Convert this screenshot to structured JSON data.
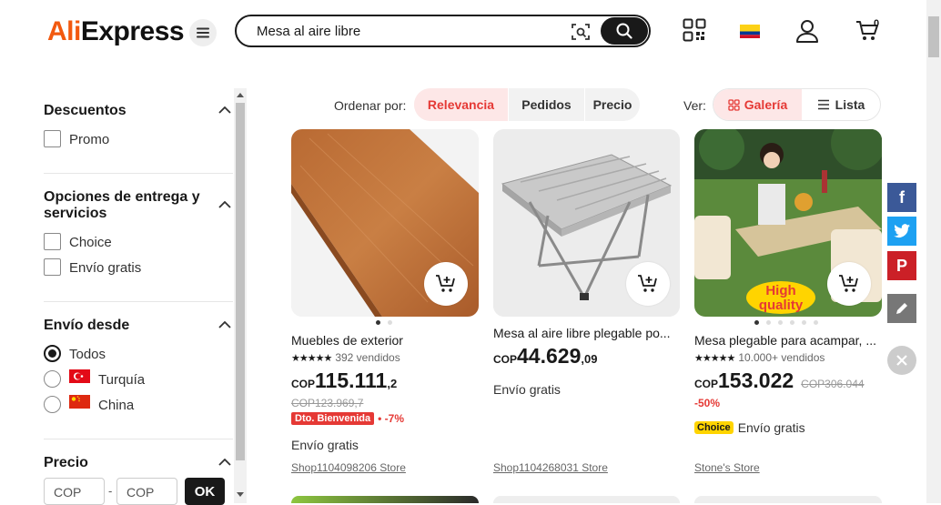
{
  "header": {
    "logo_prefix": "Ali",
    "logo_suffix": "Express",
    "search_value": "Mesa al aire libre",
    "cart_count": "0"
  },
  "sidebar": {
    "discounts": {
      "title": "Descuentos",
      "options": [
        "Promo"
      ]
    },
    "delivery": {
      "title": "Opciones de entrega y servicios",
      "options": [
        "Choice",
        "Envío gratis"
      ]
    },
    "ships_from": {
      "title": "Envío desde",
      "options": [
        "Todos",
        "Turquía",
        "China"
      ],
      "selected": "Todos"
    },
    "price": {
      "title": "Precio",
      "min_placeholder": "COP",
      "max_placeholder": "COP",
      "separator": "-",
      "ok_label": "OK"
    }
  },
  "sortbar": {
    "label": "Ordenar por:",
    "options": [
      "Relevancia",
      "Pedidos",
      "Precio"
    ],
    "active": "Relevancia",
    "view_label": "Ver:",
    "views": [
      "Galería",
      "Lista"
    ],
    "active_view": "Galería"
  },
  "products": [
    {
      "title": "Muebles de exterior",
      "sold": "392 vendidos",
      "currency": "COP",
      "price_int": "115.111",
      "price_dec": ",2",
      "old_price": "COP123.969,7",
      "promo_badge": "Dto. Bienvenida",
      "discount": "• -7%",
      "shipping": "Envío gratis",
      "store": "Shop1104098206 Store"
    },
    {
      "title": "Mesa al aire libre plegable po...",
      "currency": "COP",
      "price_int": "44.629",
      "price_dec": ",09",
      "shipping": "Envío gratis",
      "store": "Shop1104268031 Store"
    },
    {
      "title": "Mesa plegable para acampar, ...",
      "sold": "10.000+ vendidos",
      "currency": "COP",
      "price_int": "153.022",
      "old_price": "COP306.044",
      "discount": "-50%",
      "choice_badge": "Choice",
      "shipping": "Envío gratis",
      "store": "Stone's Store",
      "image_label": "High quality"
    }
  ],
  "colors": {
    "accent": "#e53935",
    "brand_orange": "#f2590f",
    "facebook": "#3b5998",
    "twitter": "#1da1f2",
    "pinterest": "#cb2027"
  }
}
